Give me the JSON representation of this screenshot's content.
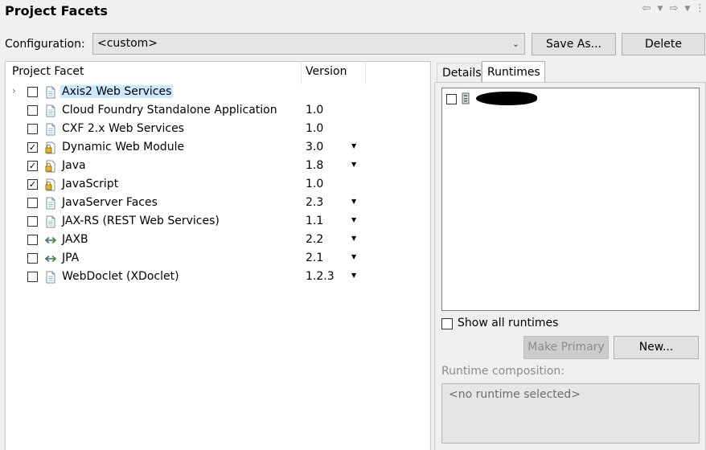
{
  "header": {
    "title": "Project Facets"
  },
  "configuration": {
    "label": "Configuration:",
    "value": "<custom>"
  },
  "buttons": {
    "save_as": "Save As...",
    "delete": "Delete",
    "make_primary": "Make Primary",
    "new": "New..."
  },
  "facets_table": {
    "columns": [
      "Project Facet",
      "Version"
    ],
    "rows": [
      {
        "name": "Axis2 Web Services",
        "version": "",
        "checked": false,
        "expandable": true,
        "selected": true,
        "icon": "page-icon",
        "has_dropdown": false
      },
      {
        "name": "Cloud Foundry Standalone Application",
        "version": "1.0",
        "checked": false,
        "icon": "page-icon",
        "has_dropdown": false
      },
      {
        "name": "CXF 2.x Web Services",
        "version": "1.0",
        "checked": false,
        "icon": "page-icon",
        "has_dropdown": false
      },
      {
        "name": "Dynamic Web Module",
        "version": "3.0",
        "checked": true,
        "icon": "locked-facet-icon",
        "has_dropdown": true
      },
      {
        "name": "Java",
        "version": "1.8",
        "checked": true,
        "icon": "locked-facet-icon",
        "has_dropdown": true
      },
      {
        "name": "JavaScript",
        "version": "1.0",
        "checked": true,
        "icon": "locked-facet-icon",
        "has_dropdown": false
      },
      {
        "name": "JavaServer Faces",
        "version": "2.3",
        "checked": false,
        "icon": "page-icon",
        "has_dropdown": true
      },
      {
        "name": "JAX-RS (REST Web Services)",
        "version": "1.1",
        "checked": false,
        "icon": "page-icon",
        "has_dropdown": true
      },
      {
        "name": "JAXB",
        "version": "2.2",
        "checked": false,
        "icon": "arrows-icon",
        "has_dropdown": true
      },
      {
        "name": "JPA",
        "version": "2.1",
        "checked": false,
        "icon": "arrows-icon",
        "has_dropdown": true
      },
      {
        "name": "WebDoclet (XDoclet)",
        "version": "1.2.3",
        "checked": false,
        "icon": "page-icon",
        "has_dropdown": true
      }
    ]
  },
  "tabs": {
    "details": "Details",
    "runtimes": "Runtimes"
  },
  "runtimes": {
    "show_all_label": "Show all runtimes",
    "composition_label": "Runtime composition:",
    "composition_value": "<no runtime selected>"
  },
  "colors": {
    "selection": "#cce8ff",
    "panel_bg": "#f0f0f0",
    "button_bg": "#e1e1e1"
  }
}
